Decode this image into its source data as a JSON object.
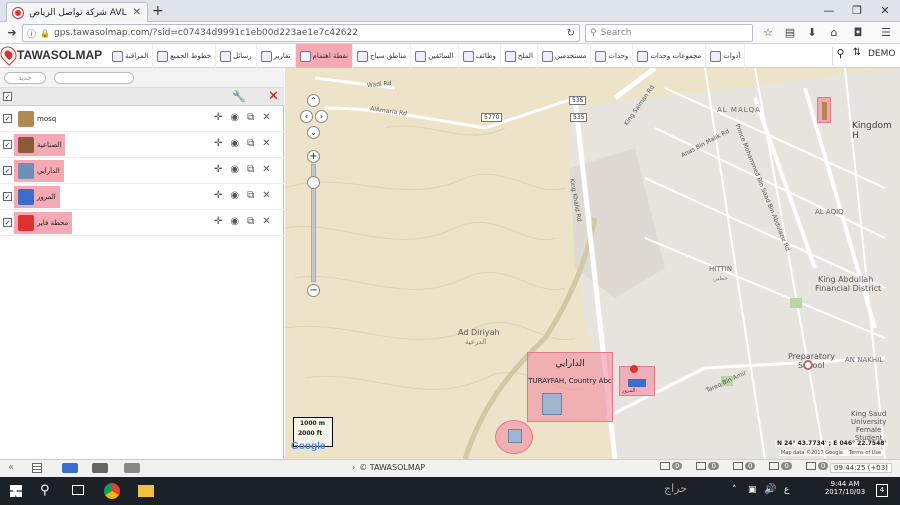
{
  "browser": {
    "tab_title": "شركة تواصل الرياض AVL",
    "url": "gps.tawasolmap.com/?sid=c07434d9991c1eb00d223ae1e7c42622",
    "search_placeholder": "Search"
  },
  "app": {
    "logo": "TAWASOLMAP",
    "user": "DEMO",
    "menu": [
      {
        "label": "المراقبة"
      },
      {
        "label": "خطوط الجميع"
      },
      {
        "label": "رسائل"
      },
      {
        "label": "تقارير"
      },
      {
        "label": "نقطة اهتمام",
        "active": true
      },
      {
        "label": "مناطق سياج"
      },
      {
        "label": "السائقين"
      },
      {
        "label": "وظائف"
      },
      {
        "label": "الملخ"
      },
      {
        "label": "مستخدمين"
      },
      {
        "label": "وحدات"
      },
      {
        "label": "مجموعات وحدات"
      },
      {
        "label": "أدوات"
      }
    ]
  },
  "panel": {
    "filter_placeholder": "جديد",
    "rows": [
      {
        "label": "mosq",
        "highlight": false,
        "icon_color": "#b08a52"
      },
      {
        "label": "الصناعية",
        "highlight": true,
        "icon_color": "#8a5a3a"
      },
      {
        "label": "الدارايي",
        "highlight": true,
        "icon_color": "#6f8fb8"
      },
      {
        "label": "المرور",
        "highlight": true,
        "icon_color": "#3a6ec8"
      },
      {
        "label": "محطة فاير",
        "highlight": true,
        "icon_color": "#e03030"
      }
    ]
  },
  "map": {
    "labels": {
      "al_malqa": "AL MALQA",
      "kingdom": "Kingdom H",
      "al_aqiq": "AL AQIQ",
      "hittin": "HITTIN",
      "hittin_ar": "حطين",
      "kafd1": "King Abdullah",
      "kafd2": "Financial District",
      "ad_diriyah": "Ad Diriyah",
      "ad_diriyah_ar": "الدرعية",
      "preparatory": "Preparatory",
      "school": "School",
      "an_nakhil": "AN NAKHIL",
      "ksu1": "King Saud",
      "ksu2": "University",
      "ksu3": "Female",
      "ksu4": "Student",
      "wadi": "Wadi Hanifah",
      "poi_title": "الدارايي",
      "poi_sub": "TURAYFAH, Country Abc",
      "poi_small": "المرور"
    },
    "roads": {
      "wadi_rd": "Wadi Rd",
      "alamaria": "AlAmaria Rd",
      "king_khalid": "King Khalid Rd",
      "king_salman": "King Salman Rd",
      "anas": "Anas Bin Malik Rd",
      "imam_saud": "Imam Saud Bin Abdulaziz Rd",
      "turki": "Turki Bin Abdullah Rd",
      "prince": "Prince Mohammed Bin Saad Bin Abdulaziz Rd",
      "tareq": "Tareq Bin Amir",
      "shield1": "535",
      "shield2": "5770",
      "shield3": "535"
    },
    "scale_m": "1000 m",
    "scale_ft": "2000 ft",
    "coords": "N 24° 43.7734' ; E 046° 22.7548'",
    "attribution": "Map data ©2017 Google",
    "terms": "Terms of Use",
    "google": "Google"
  },
  "bottombar": {
    "brand": "© TAWASOLMAP",
    "counters": [
      "0",
      "0",
      "0",
      "0",
      "0"
    ],
    "time": "09:44:25 (+03)"
  },
  "taskbar": {
    "time": "9:44 AM",
    "date": "2017/10/03",
    "notif": "4",
    "lang": "ع"
  }
}
